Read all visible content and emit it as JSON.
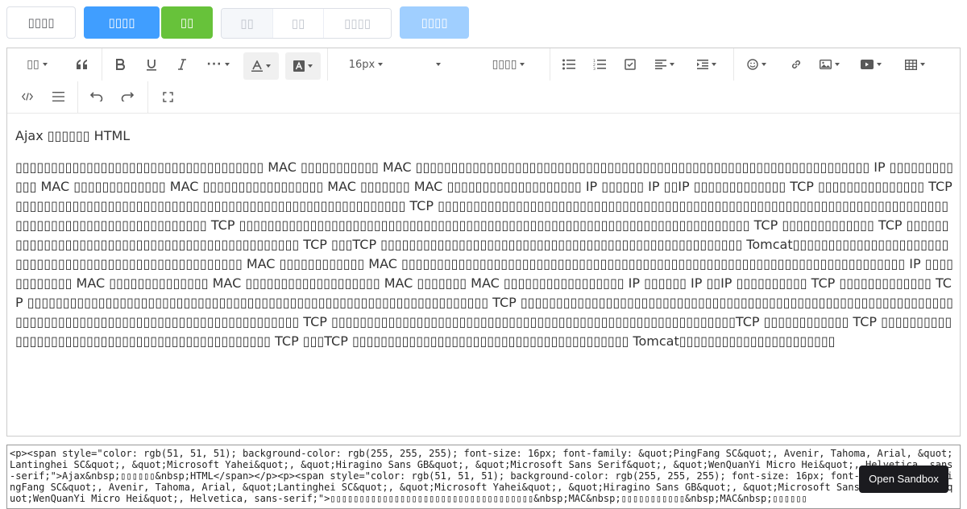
{
  "top_buttons": [
    {
      "label": "▯▯▯▯",
      "style": "default"
    },
    {
      "label": "▯▯▯▯",
      "style": "primary"
    },
    {
      "label": "▯▯",
      "style": "success"
    }
  ],
  "button_group": [
    "▯▯",
    "▯▯",
    "▯▯▯▯"
  ],
  "disabled_button": "▯▯▯▯",
  "toolbar": {
    "heading": "▯▯",
    "font_size": "16px",
    "font_family": "▯▯▯▯"
  },
  "content": {
    "title": "Ajax ▯▯▯▯▯▯ HTML",
    "paragraph": "▯▯▯▯▯▯▯▯▯▯▯▯▯▯▯▯▯▯▯▯▯▯▯▯▯▯▯▯▯▯▯▯▯▯▯ MAC ▯▯▯▯▯▯▯▯▯▯▯ MAC ▯▯▯▯▯▯▯▯▯▯▯▯▯▯▯▯▯▯▯▯▯▯▯▯▯▯▯▯▯▯▯▯▯▯▯▯▯▯▯▯▯▯▯▯▯▯▯▯▯▯▯▯▯▯▯▯▯▯▯▯▯▯▯▯ IP ▯▯▯▯▯▯▯▯▯▯▯▯ MAC ▯▯▯▯▯▯▯▯▯▯▯▯▯ MAC ▯▯▯▯▯▯▯▯▯▯▯▯▯▯▯▯▯ MAC ▯▯▯▯▯▯▯ MAC ▯▯▯▯▯▯▯▯▯▯▯▯▯▯▯▯▯▯▯ IP ▯▯▯▯▯▯ IP ▯▯IP ▯▯▯▯▯▯▯▯▯▯▯▯▯ TCP ▯▯▯▯▯▯▯▯▯▯▯▯▯▯▯ TCP ▯▯▯▯▯▯▯▯▯▯▯▯▯▯▯▯▯▯▯▯▯▯▯▯▯▯▯▯▯▯▯▯▯▯▯▯▯▯▯▯▯▯▯▯▯▯▯▯▯▯▯▯▯▯▯ TCP ▯▯▯▯▯▯▯▯▯▯▯▯▯▯▯▯▯▯▯▯▯▯▯▯▯▯▯▯▯▯▯▯▯▯▯▯▯▯▯▯▯▯▯▯▯▯▯▯▯▯▯▯▯▯▯▯▯▯▯▯▯▯▯▯▯▯▯▯▯▯▯▯▯▯▯▯▯▯▯▯▯▯▯▯▯▯▯▯▯▯▯▯▯▯▯▯▯▯▯ TCP ▯▯▯▯▯▯▯▯▯▯▯▯▯▯▯▯▯▯▯▯▯▯▯▯▯▯▯▯▯▯▯▯▯▯▯▯▯▯▯▯▯▯▯▯▯▯▯▯▯▯▯▯▯▯▯▯▯▯▯▯▯▯▯▯▯▯▯▯▯▯▯▯ TCP ▯▯▯▯▯▯▯▯▯▯▯▯▯ TCP ▯▯▯▯▯▯▯▯▯▯▯▯▯▯▯▯▯▯▯▯▯▯▯▯▯▯▯▯▯▯▯▯▯▯▯▯▯▯▯▯▯▯▯▯▯▯ TCP ▯▯▯TCP ▯▯▯▯▯▯▯▯▯▯▯▯▯▯▯▯▯▯▯▯▯▯▯▯▯▯▯▯▯▯▯▯▯▯▯▯▯▯▯▯▯▯▯▯▯▯▯▯▯▯▯ Tomcat▯▯▯▯▯▯▯▯▯▯▯▯▯▯▯▯▯▯▯▯▯▯▯▯▯▯▯▯▯▯▯▯▯▯▯▯▯▯▯▯▯▯▯▯▯▯▯▯▯▯▯▯▯▯ MAC ▯▯▯▯▯▯▯▯▯▯▯▯ MAC ▯▯▯▯▯▯▯▯▯▯▯▯▯▯▯▯▯▯▯▯▯▯▯▯▯▯▯▯▯▯▯▯▯▯▯▯▯▯▯▯▯▯▯▯▯▯▯▯▯▯▯▯▯▯▯▯▯▯▯▯▯▯▯▯▯▯▯▯▯▯▯ IP ▯▯▯▯▯▯▯▯▯▯▯▯ MAC ▯▯▯▯▯▯▯▯▯▯▯▯▯▯ MAC ▯▯▯▯▯▯▯▯▯▯▯▯▯▯▯▯▯▯▯ MAC ▯▯▯▯▯▯▯ MAC ▯▯▯▯▯▯▯▯▯▯▯▯▯▯▯▯▯ IP ▯▯▯▯▯▯ IP ▯▯IP ▯▯▯▯▯▯▯▯▯▯ TCP ▯▯▯▯▯▯▯▯▯▯▯▯▯ TCP ▯▯▯▯▯▯▯▯▯▯▯▯▯▯▯▯▯▯▯▯▯▯▯▯▯▯▯▯▯▯▯▯▯▯▯▯▯▯▯▯▯▯▯▯▯▯▯▯▯▯▯▯▯▯▯▯▯▯▯▯▯▯▯▯▯ TCP ▯▯▯▯▯▯▯▯▯▯▯▯▯▯▯▯▯▯▯▯▯▯▯▯▯▯▯▯▯▯▯▯▯▯▯▯▯▯▯▯▯▯▯▯▯▯▯▯▯▯▯▯▯▯▯▯▯▯▯▯▯▯▯▯▯▯▯▯▯▯▯▯▯▯▯▯▯▯▯▯▯▯▯▯▯▯▯▯▯▯▯▯▯▯▯▯▯▯▯▯▯ TCP ▯▯▯▯▯▯▯▯▯▯▯▯▯▯▯▯▯▯▯▯▯▯▯▯▯▯▯▯▯▯▯▯▯▯▯▯▯▯▯▯▯▯▯▯▯▯▯▯▯▯▯▯▯▯▯▯▯TCP ▯▯▯▯▯▯▯▯▯▯▯▯ TCP ▯▯▯▯▯▯▯▯▯▯▯▯▯▯▯▯▯▯▯▯▯▯▯▯▯▯▯▯▯▯▯▯▯▯▯▯▯▯▯▯▯▯▯▯▯▯ TCP ▯▯▯TCP ▯▯▯▯▯▯▯▯▯▯▯▯▯▯▯▯▯▯▯▯▯▯▯▯▯▯▯▯▯▯▯▯▯▯▯▯▯▯▯ Tomcat▯▯▯▯▯▯▯▯▯▯▯▯▯▯▯▯▯▯▯▯▯▯"
  },
  "source_html": "<p><span style=\"color: rgb(51, 51, 51); background-color: rgb(255, 255, 255); font-size: 16px; font-family: &quot;PingFang SC&quot;, Avenir, Tahoma, Arial, &quot;Lantinghei SC&quot;, &quot;Microsoft Yahei&quot;, &quot;Hiragino Sans GB&quot;, &quot;Microsoft Sans Serif&quot;, &quot;WenQuanYi Micro Hei&quot;, Helvetica, sans-serif;\">Ajax&nbsp;▯▯▯▯▯▯&nbsp;HTML</span></p><p><span style=\"color: rgb(51, 51, 51); background-color: rgb(255, 255, 255); font-size: 16px; font-family: &quot;PingFang SC&quot;, Avenir, Tahoma, Arial, &quot;Lantinghei SC&quot;, &quot;Microsoft Yahei&quot;, &quot;Hiragino Sans GB&quot;, &quot;Microsoft Sans Serif&quot;, &quot;WenQuanYi Micro Hei&quot;, Helvetica, sans-serif;\">▯▯▯▯▯▯▯▯▯▯▯▯▯▯▯▯▯▯▯▯▯▯▯▯▯▯▯▯▯▯▯▯▯▯▯&nbsp;MAC&nbsp;▯▯▯▯▯▯▯▯▯▯▯&nbsp;MAC&nbsp;▯▯▯▯▯▯",
  "sandbox_label": "Open Sandbox",
  "colors": {
    "primary": "#409eff",
    "success": "#67c23a",
    "disabled": "#a0cfff"
  }
}
